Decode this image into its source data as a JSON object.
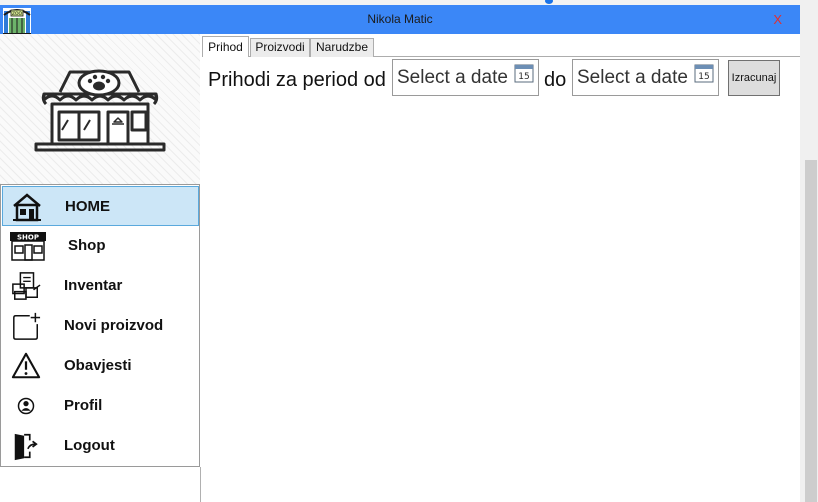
{
  "window": {
    "title": "Nikola Matic",
    "close_label": "X",
    "accent_color": "#3b87f7"
  },
  "app_icon": {
    "name": "zoo-gate-icon",
    "text": "ZOO"
  },
  "logo": {
    "name": "pet-shop-storefront-icon"
  },
  "nav": {
    "items": [
      {
        "label": "HOME",
        "icon": "house-icon",
        "active": true
      },
      {
        "label": "Shop",
        "icon": "shop-icon",
        "icon_text": "SHOP",
        "active": false
      },
      {
        "label": "Inventar",
        "icon": "inventory-boxes-icon",
        "active": false
      },
      {
        "label": "Novi proizvod",
        "icon": "add-square-icon",
        "active": false
      },
      {
        "label": "Obavjesti",
        "icon": "warning-icon",
        "active": false
      },
      {
        "label": "Profil",
        "icon": "user-icon",
        "active": false
      },
      {
        "label": "Logout",
        "icon": "logout-door-icon",
        "active": false
      }
    ],
    "active_color": "#cce6f7"
  },
  "tabs": [
    {
      "label": "Prihod",
      "active": true
    },
    {
      "label": "Proizvodi",
      "active": false
    },
    {
      "label": "Narudzbe",
      "active": false
    }
  ],
  "revenue": {
    "period_label": "Prihodi za period od",
    "to_label": "do",
    "from_date": {
      "placeholder": "Select a date",
      "calendar_day": "15"
    },
    "to_date": {
      "placeholder": "Select a date",
      "calendar_day": "15"
    },
    "calculate_button": "Izracunaj"
  }
}
